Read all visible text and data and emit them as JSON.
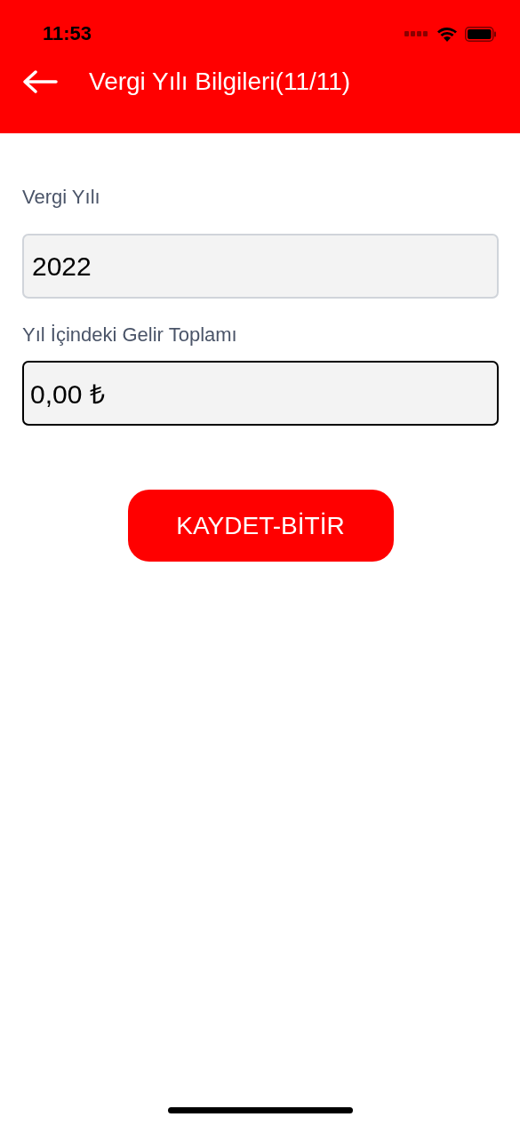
{
  "status_bar": {
    "time": "11:53"
  },
  "header": {
    "title": "Vergi Yılı Bilgileri(11/11)"
  },
  "fields": [
    {
      "label": "Vergi Yılı",
      "value": "2022",
      "focused": false
    },
    {
      "label": "Yıl İçindeki Gelir Toplamı",
      "value": "0,00 ₺",
      "focused": true
    }
  ],
  "submit_button": {
    "label": "KAYDET-BİTİR"
  }
}
